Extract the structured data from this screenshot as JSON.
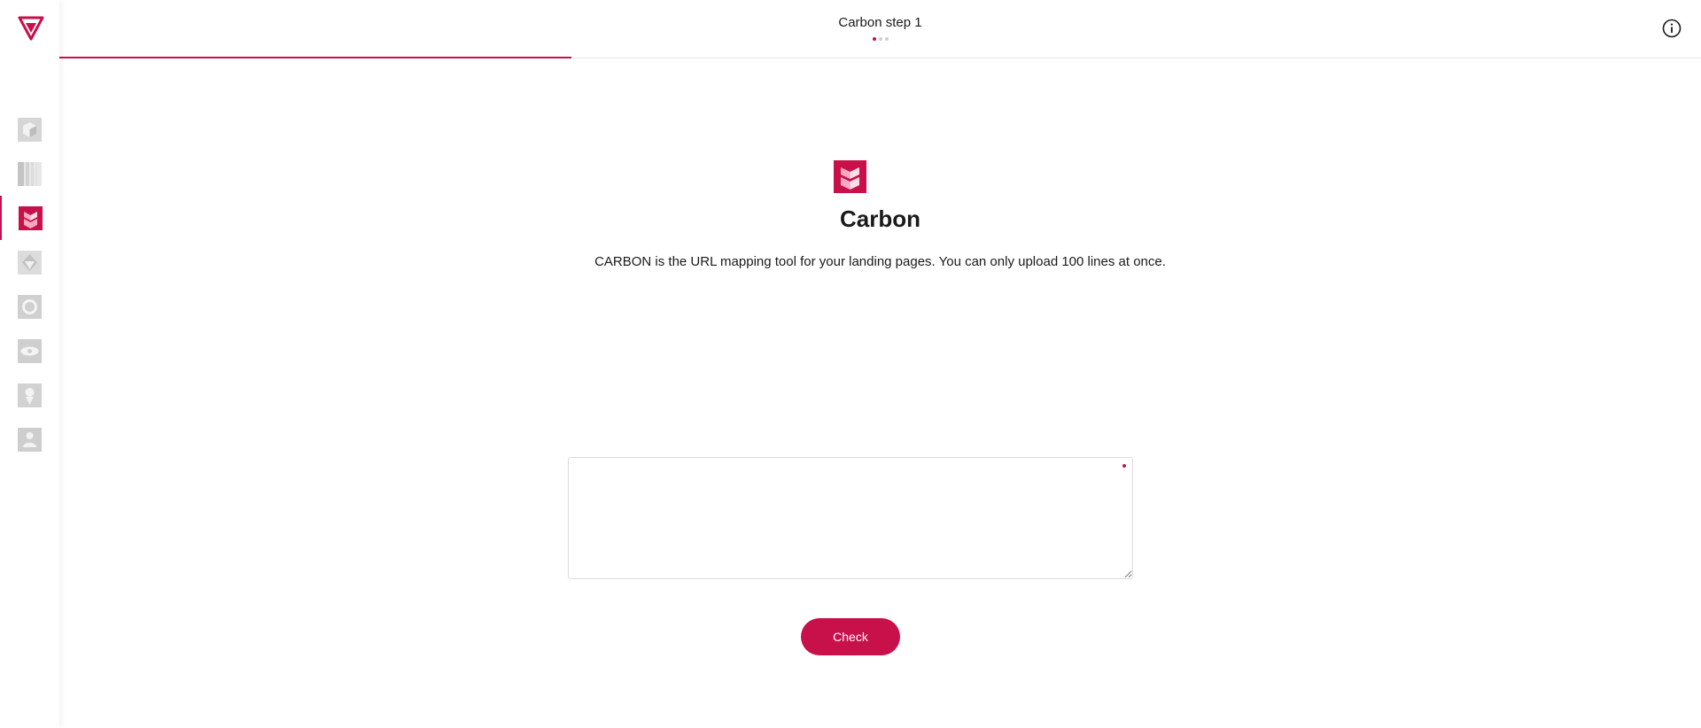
{
  "header": {
    "step_title": "Carbon step 1",
    "step_count": 3,
    "current_step": 1,
    "progress_fraction": 0.31
  },
  "sidebar": {
    "logo_icon": "brand-logo-icon",
    "items": [
      {
        "icon": "cube-tool-icon",
        "active": false
      },
      {
        "icon": "stripes-tool-icon",
        "active": false
      },
      {
        "icon": "carbon-tool-icon",
        "active": true
      },
      {
        "icon": "diamond-tool-icon",
        "active": false
      },
      {
        "icon": "ring-tool-icon",
        "active": false
      },
      {
        "icon": "eye-tool-icon",
        "active": false
      },
      {
        "icon": "pin-tool-icon",
        "active": false
      },
      {
        "icon": "person-tool-icon",
        "active": false
      }
    ]
  },
  "main": {
    "title": "Carbon",
    "description": "CARBON is the URL mapping tool for your landing pages. You can only upload 100 lines at once.",
    "input_value": "",
    "input_placeholder": "",
    "submit_label": "Check"
  },
  "colors": {
    "accent": "#c8104a",
    "inactive_icon": "#d0d0d0"
  }
}
